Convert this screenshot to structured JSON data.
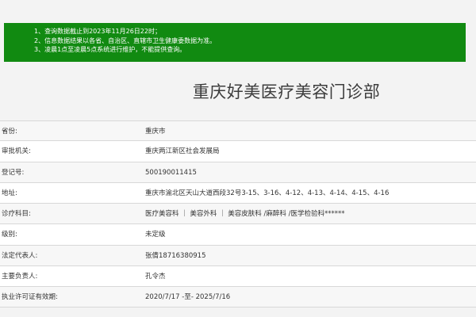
{
  "notice": {
    "lines": [
      "1、查询数据截止到2023年11月26日22时；",
      "2、信息数据结果以各省、自治区、直辖市卫生健康委数据为准。",
      "3、凌晨1点至凌晨5点系统进行维护，不能提供查询。"
    ]
  },
  "page_title": "重庆好美医疗美容门诊部",
  "fields": [
    {
      "label": "省份:",
      "value": "重庆市"
    },
    {
      "label": "审批机关:",
      "value": "重庆两江新区社会发展局"
    },
    {
      "label": "登记号:",
      "value": "500190011415"
    },
    {
      "label": "地址:",
      "value": "重庆市渝北区天山大道西段32号3-15、3-16、4-12、4-13、4-14、4-15、4-16"
    },
    {
      "label": "诊疗科目:",
      "value": "医疗美容科 ｜ 美容外科 ｜ 美容皮肤科 /麻醉科 /医学检验科******"
    },
    {
      "label": "级别:",
      "value": "未定级"
    },
    {
      "label": "法定代表人:",
      "value": "张倩18716380915"
    },
    {
      "label": "主要负责人:",
      "value": "孔令杰"
    },
    {
      "label": "执业许可证有效期:",
      "value": "2020/7/17 -至- 2025/7/16"
    }
  ]
}
